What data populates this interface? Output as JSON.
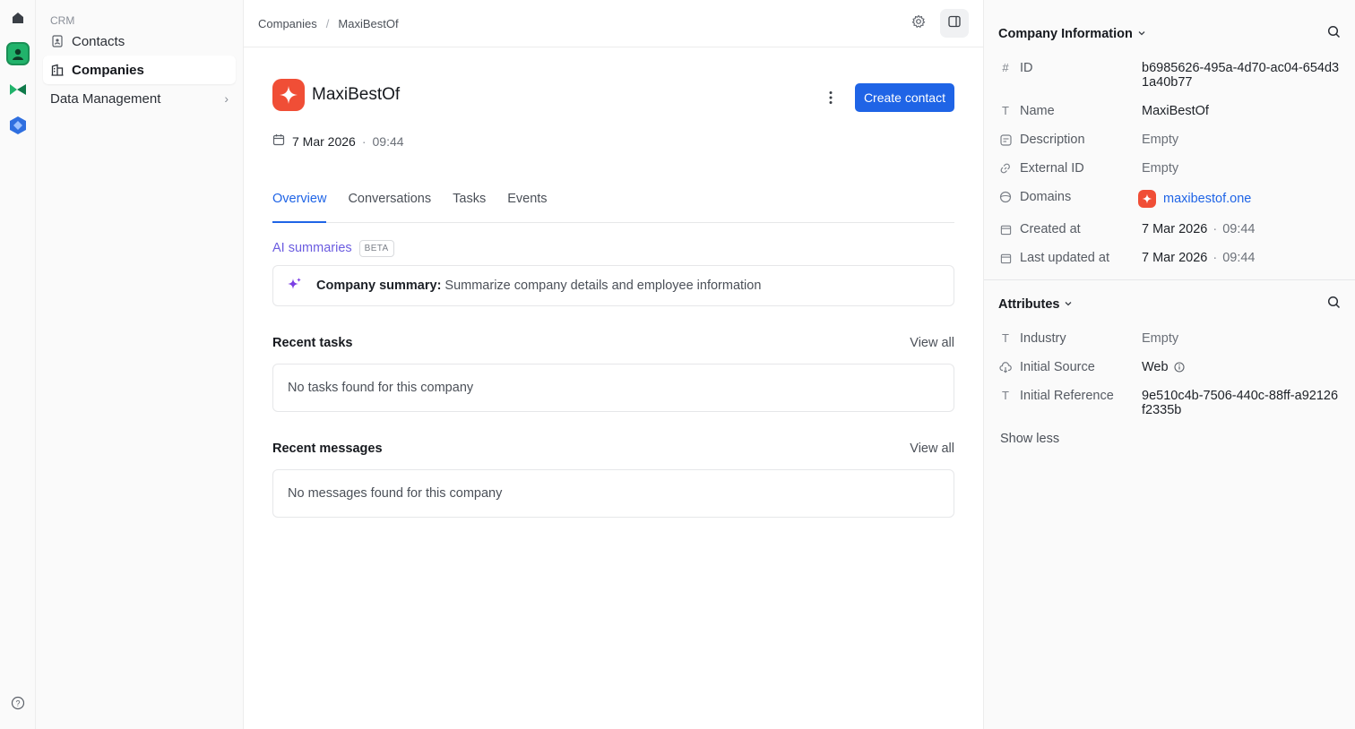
{
  "sidebar": {
    "section": "CRM",
    "items": [
      {
        "label": "Contacts",
        "icon": "contact-book-icon"
      },
      {
        "label": "Companies",
        "icon": "building-icon",
        "active": true
      },
      {
        "label": "Data Management",
        "icon": "",
        "chevron": true
      }
    ]
  },
  "breadcrumb": {
    "parent": "Companies",
    "current": "MaxiBestOf"
  },
  "company": {
    "name": "MaxiBestOf",
    "created_date": "7 Mar 2026",
    "created_time": "09:44",
    "logo_color": "#f04e36"
  },
  "actions": {
    "create_contact": "Create contact"
  },
  "tabs": [
    {
      "label": "Overview",
      "active": true
    },
    {
      "label": "Conversations"
    },
    {
      "label": "Tasks"
    },
    {
      "label": "Events"
    }
  ],
  "ai": {
    "label": "AI summaries",
    "badge": "BETA",
    "summary_title": "Company summary:",
    "summary_text": "Summarize company details and employee information"
  },
  "recent_tasks": {
    "title": "Recent tasks",
    "view_all": "View all",
    "empty": "No tasks found for this company"
  },
  "recent_messages": {
    "title": "Recent messages",
    "view_all": "View all",
    "empty": "No messages found for this company"
  },
  "panel": {
    "info_title": "Company Information",
    "fields": [
      {
        "label": "ID",
        "value": "b6985626-495a-4d70-ac04-654d31a40b77"
      },
      {
        "label": "Name",
        "value": "MaxiBestOf"
      },
      {
        "label": "Description",
        "value": "Empty"
      },
      {
        "label": "External ID",
        "value": "Empty"
      },
      {
        "label": "Domains",
        "value": "maxibestof.one"
      },
      {
        "label": "Created at",
        "date": "7 Mar 2026",
        "time": "09:44"
      },
      {
        "label": "Last updated at",
        "date": "7 Mar 2026",
        "time": "09:44"
      }
    ],
    "attributes_title": "Attributes",
    "attributes": [
      {
        "label": "Industry",
        "value": "Empty"
      },
      {
        "label": "Initial Source",
        "value": "Web"
      },
      {
        "label": "Initial Reference",
        "value": "9e510c4b-7506-440c-88ff-a92126f2335b"
      }
    ],
    "show_less": "Show less"
  },
  "colors": {
    "accent": "#1f64e6",
    "ai": "#6b5ce0"
  }
}
